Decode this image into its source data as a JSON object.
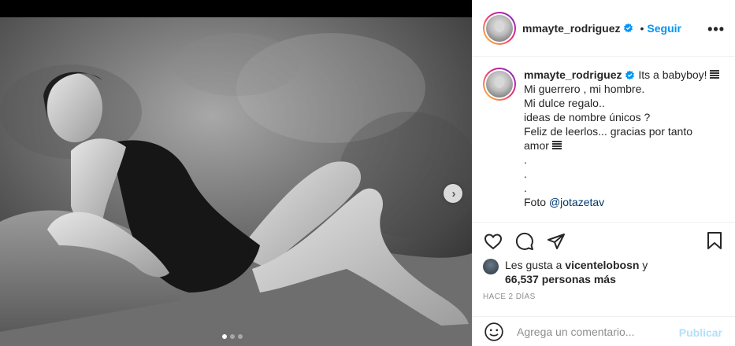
{
  "header": {
    "username": "mmayte_rodriguez",
    "separator": "•",
    "follow_label": "Seguir",
    "more_label": "•••"
  },
  "caption": {
    "username": "mmayte_rodriguez",
    "first_line_text": " Its a babyboy! ",
    "lines": [
      "Mi guerrero , mi hombre.",
      "Mi dulce regalo..",
      "ideas de nombre únicos ?",
      "Feliz de leerlos... gracias por tanto"
    ],
    "amor": "amor ",
    "dots": [
      ".",
      ".",
      "."
    ],
    "photo_credit_prefix": "Foto ",
    "photo_credit_mention": "@jotazetav"
  },
  "likes": {
    "prefix": "Les gusta a ",
    "user": "vicentelobosn",
    "suffix": " y",
    "count": "66,537 personas más"
  },
  "time": "HACE 2 DÍAS",
  "comment": {
    "placeholder": "Agrega un comentario...",
    "publish_label": "Publicar"
  },
  "carousel": {
    "slides": 3,
    "active": 0
  },
  "colors": {
    "accent": "#0095f6",
    "publish_disabled": "#b2dffc",
    "mention": "#00376b",
    "muted": "#8e8e8e"
  }
}
